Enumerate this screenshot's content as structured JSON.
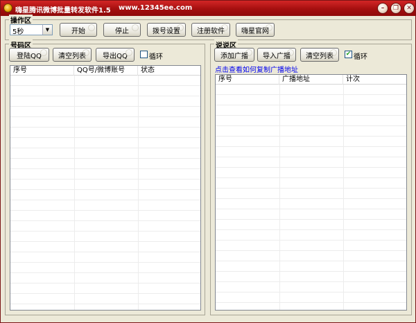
{
  "window": {
    "title": "嗨星腾讯微博批量转发软件1.5",
    "url": "www.12345ee.com",
    "controls": {
      "minimize": "–",
      "restore": "❐",
      "close": "✕"
    }
  },
  "operation": {
    "label": "操作区",
    "interval_value": "5秒",
    "buttons": {
      "start": "开始",
      "stop": "停止",
      "dial": "拨号设置",
      "register": "注册软件",
      "website": "嗨星官网"
    }
  },
  "accounts": {
    "label": "号码区",
    "buttons": {
      "login": "登陆QQ",
      "clear": "清空列表",
      "export": "导出QQ"
    },
    "loop_label": "循环",
    "loop_checked": false,
    "columns": [
      "序号",
      "QQ号/微博账号",
      "状态"
    ]
  },
  "talk": {
    "label": "说说区",
    "buttons": {
      "add": "添加广播",
      "import": "导入广播",
      "clear": "清空列表"
    },
    "loop_label": "循环",
    "loop_checked": true,
    "help_link": "点击查看如何复制广播地址",
    "columns": [
      "序号",
      "广播地址",
      "计次"
    ]
  },
  "colors": {
    "titlebar": "#b31515",
    "link": "#0000ee",
    "face": "#ece9d8"
  }
}
